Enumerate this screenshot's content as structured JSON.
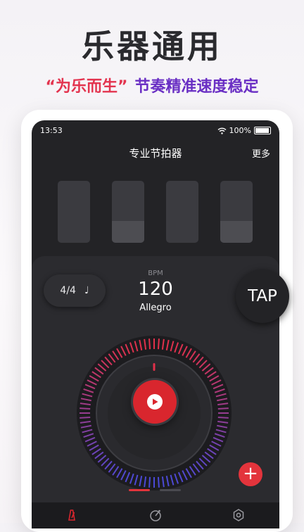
{
  "promo": {
    "headline": "乐器通用",
    "tagline_quote": "“为乐而生”",
    "tagline_rest": "节奏精准速度稳定"
  },
  "status_bar": {
    "time": "13:53",
    "battery": "100%"
  },
  "nav": {
    "title": "专业节拍器",
    "more": "更多"
  },
  "beats": [
    {
      "level": 0.0
    },
    {
      "level": 0.35
    },
    {
      "level": 0.0
    },
    {
      "level": 0.35
    }
  ],
  "metronome": {
    "time_signature": "4/4",
    "note_symbol": "♩",
    "bpm_label": "BPM",
    "bpm": "120",
    "tempo_name": "Allegro",
    "tap_label": "TAP",
    "add_label": "+"
  },
  "pager": {
    "active_index": 0,
    "count": 2
  },
  "tabs": [
    {
      "icon": "metronome-icon",
      "active": true
    },
    {
      "icon": "tuner-icon",
      "active": false
    },
    {
      "icon": "settings-icon",
      "active": false
    }
  ],
  "colors": {
    "accent_red": "#e3344f",
    "accent_purple": "#6a2fc4",
    "play_red": "#d9262e",
    "dial_red": "#e2304a",
    "dial_blue": "#4a49d6"
  }
}
